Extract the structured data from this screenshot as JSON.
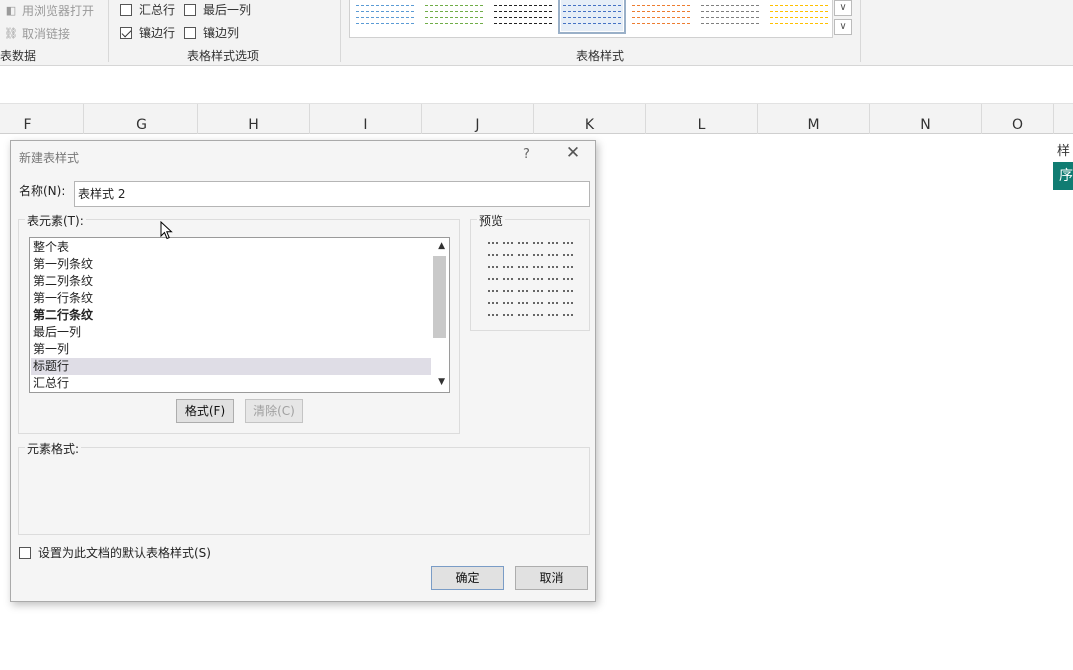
{
  "ribbon": {
    "external_data": {
      "open_in_browser": "用浏览器打开",
      "unlink": "取消链接",
      "group_label": "表数据"
    },
    "style_options": {
      "total_row": {
        "label": "汇总行",
        "checked": false
      },
      "last_column": {
        "label": "最后一列",
        "checked": false
      },
      "banded_rows": {
        "label": "镶边行",
        "checked": true
      },
      "banded_columns": {
        "label": "镶边列",
        "checked": false
      },
      "group_label": "表格样式选项"
    },
    "table_styles": {
      "group_label": "表格样式",
      "thumbnail_colors": [
        "#5b9bd5",
        "#70ad47",
        "#222222",
        "#4472c4",
        "#ed7d31",
        "#7f7f7f",
        "#ffc000"
      ]
    }
  },
  "columns": [
    "F",
    "G",
    "H",
    "I",
    "J",
    "K",
    "L",
    "M",
    "N",
    "O"
  ],
  "side_panel": {
    "title": "样",
    "header": "序",
    "accent": "#107c72"
  },
  "dialog": {
    "title": "新建表样式",
    "help": "?",
    "close": "✕",
    "name_label": "名称(N):",
    "name_value": "表样式 2",
    "elements_legend": "表元素(T):",
    "elements": [
      "整个表",
      "第一列条纹",
      "第二列条纹",
      "第一行条纹",
      "第二行条纹",
      "最后一列",
      "第一列",
      "标题行",
      "汇总行"
    ],
    "bold_element": "第二行条纹",
    "hovered_element": "标题行",
    "format_button": "格式(F)",
    "clear_button": "清除(C)",
    "preview_legend": "预览",
    "element_format_legend": "元素格式:",
    "default_checkbox": "设置为此文档的默认表格样式(S)",
    "ok_button": "确定",
    "cancel_button": "取消"
  }
}
